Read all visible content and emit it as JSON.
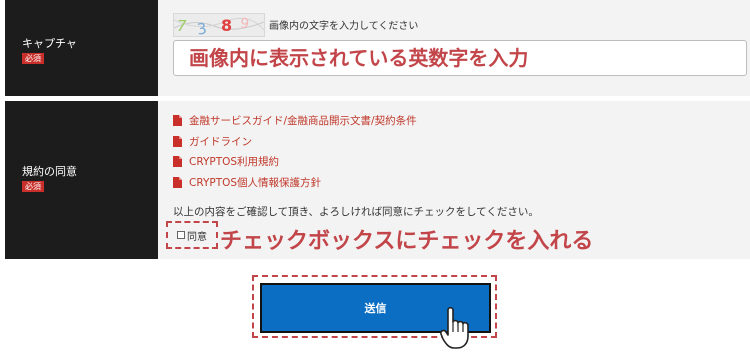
{
  "captcha_row": {
    "label": "キャプチャ",
    "required_badge": "必須",
    "captcha_image_text": "7 3 8 9",
    "hint": "画像内の文字を入力してください",
    "input_placeholder": "画像内に表示されている英数字を入力",
    "input_value": ""
  },
  "agreement_row": {
    "label": "規約の同意",
    "required_badge": "必須",
    "documents": [
      {
        "label": "金融サービスガイド/金融商品開示文書/契約条件",
        "icon": "pdf-icon"
      },
      {
        "label": "ガイドライン",
        "icon": "pdf-icon"
      },
      {
        "label": "CRYPTOS利用規約",
        "icon": "pdf-icon"
      },
      {
        "label": "CRYPTOS個人情報保護方針",
        "icon": "pdf-icon"
      }
    ],
    "confirm_text": "以上の内容をご確認して頂き、よろしければ同意にチェックをしてください。",
    "agree_label": "同意",
    "agree_checked": false,
    "annotation": "チェックボックスにチェックを入れる"
  },
  "submit": {
    "label": "送信"
  },
  "colors": {
    "label_bg": "#1c1c1c",
    "content_bg": "#f3f3f3",
    "badge": "#c9302c",
    "annotation": "#c2454a",
    "link": "#c0392b",
    "button": "#0b6ec2"
  }
}
